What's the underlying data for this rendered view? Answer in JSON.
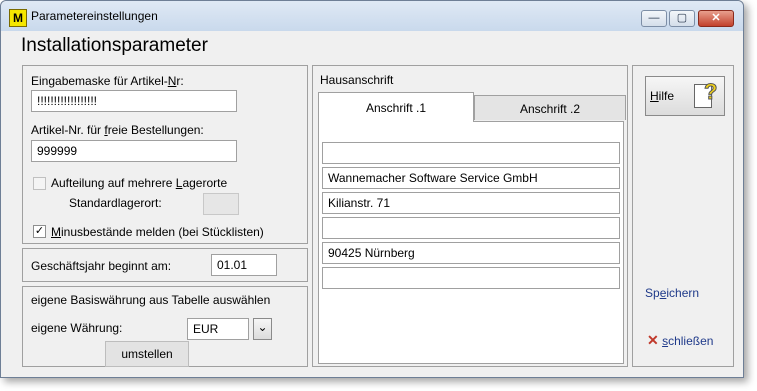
{
  "window": {
    "title": "Parametereinstellungen",
    "app_icon_letter": "M",
    "minimize_glyph": "—",
    "maximize_glyph": "▢",
    "close_glyph": "✕"
  },
  "heading": "Installationsparameter",
  "left": {
    "eingabemaske_label": "Eingabemaske für Artikel-Nr:",
    "eingabemaske_value": "!!!!!!!!!!!!!!!!!!",
    "freie_label": "Artikel-Nr. für freie Bestellungen:",
    "freie_value": "999999",
    "aufteilung_label": "Aufteilung auf mehrere Lagerorte",
    "aufteilung_checked": false,
    "standardlagerort_label": "Standardlagerort:",
    "standardlagerort_value": "",
    "minus_label": "Minusbestände melden (bei Stücklisten)",
    "minus_checked": true,
    "minus_check_glyph": "✓",
    "geschaeftsjahr_label": "Geschäftsjahr beginnt am:",
    "geschaeftsjahr_value": "01.01",
    "basiswaehrung_label": "eigene Basiswährung aus Tabelle auswählen",
    "waehrung_label": "eigene Währung:",
    "waehrung_value": "EUR",
    "dropdown_glyph": "⌄",
    "umstellen_label": "umstellen"
  },
  "address": {
    "section_label": "Hausanschrift",
    "tabs": [
      {
        "label": "Anschrift .1",
        "active": true
      },
      {
        "label": "Anschrift .2",
        "active": false
      }
    ],
    "lines": [
      "",
      "Wannemacher Software Service GmbH",
      "Kilianstr. 71",
      "",
      "90425 Nürnberg",
      ""
    ]
  },
  "right": {
    "hilfe_label": "Hilfe",
    "hilfe_icon_glyph": "?",
    "speichern_label": "Speichern",
    "schliessen_label": "schließen",
    "schliessen_icon_glyph": "✕"
  },
  "colors": {
    "link": "#1f3a8a",
    "close_x": "#c0392b",
    "help_icon": "#f2d21a"
  }
}
